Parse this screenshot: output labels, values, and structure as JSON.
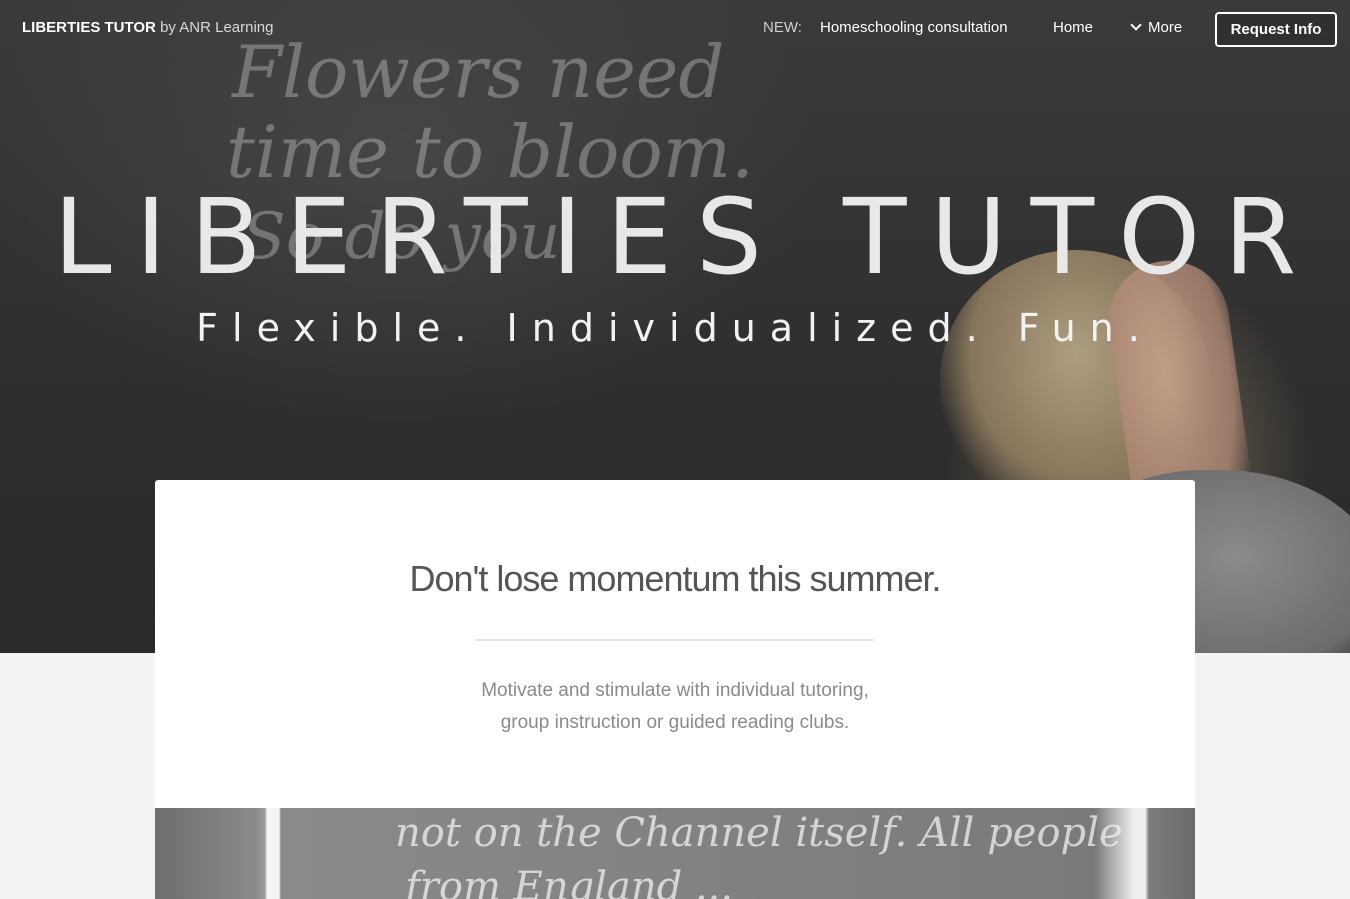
{
  "nav": {
    "brand_name": "LIBERTIES TUTOR",
    "brand_suffix": "by ANR Learning",
    "new_label": "NEW:",
    "link_consultation": "Homeschooling consultation",
    "link_home": "Home",
    "link_more": "More",
    "cta_label": "Request Info"
  },
  "hero": {
    "title": "LIBERTIES TUTOR",
    "subtitle": "Flexible. Individualized. Fun.",
    "chalk_line_1": "Flowers need",
    "chalk_line_2": "time to bloom.",
    "chalk_line_3": "So do you"
  },
  "card": {
    "heading": "Don't lose momentum this summer.",
    "body_line_1": "Motivate and stimulate with individual tutoring,",
    "body_line_2": "group instruction or guided reading clubs.",
    "image_chalk_1": "not on the Channel itself. All people",
    "image_chalk_2": "from England ..."
  },
  "colors": {
    "card_background": "#ffffff",
    "page_background": "#f3f3f3",
    "heading_text": "#555555",
    "body_text": "#8a8a8a"
  }
}
